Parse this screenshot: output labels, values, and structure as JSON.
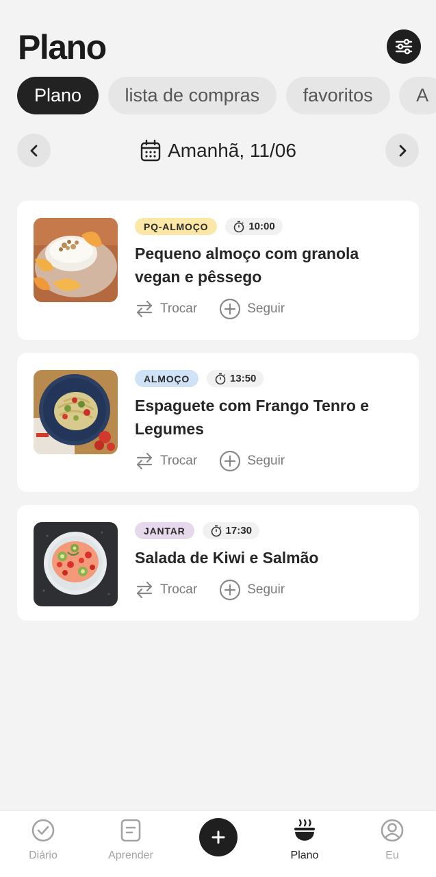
{
  "header": {
    "title": "Plano",
    "filter_icon": "sliders-icon"
  },
  "tabs": [
    {
      "label": "Plano",
      "active": true
    },
    {
      "label": "lista de compras",
      "active": false
    },
    {
      "label": "favoritos",
      "active": false
    },
    {
      "label": "A",
      "active": false
    }
  ],
  "date_bar": {
    "label": "Amanhã, 11/06",
    "prev_icon": "chevron-left-icon",
    "next_icon": "chevron-right-icon",
    "calendar_icon": "calendar-icon"
  },
  "meals": [
    {
      "tag": "PQ-ALMOÇO",
      "tag_color": "#fbe8a6",
      "time": "10:00",
      "title": "Pequeno almoço com granola vegan e pêssego",
      "swap_label": "Trocar",
      "follow_label": "Seguir"
    },
    {
      "tag": "ALMOÇO",
      "tag_color": "#cfe2f6",
      "time": "13:50",
      "title": "Espaguete com Frango Tenro e Legumes",
      "swap_label": "Trocar",
      "follow_label": "Seguir"
    },
    {
      "tag": "JANTAR",
      "tag_color": "#e6d9ec",
      "time": "17:30",
      "title": "Salada de Kiwi e Salmão",
      "swap_label": "Trocar",
      "follow_label": "Seguir"
    }
  ],
  "bottom_nav": {
    "diario": "Diário",
    "aprender": "Aprender",
    "plano": "Plano",
    "eu": "Eu",
    "active": "Plano"
  }
}
